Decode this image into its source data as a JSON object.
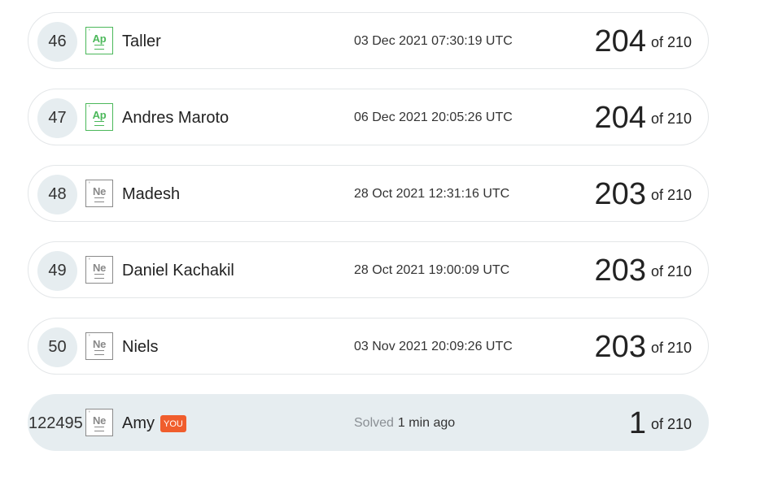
{
  "leaderboard": {
    "rows": [
      {
        "rank": "46",
        "badge": "Ap",
        "name": "Taller",
        "date": "03 Dec 2021 07:30:19 UTC",
        "score": "204",
        "total": "of 210"
      },
      {
        "rank": "47",
        "badge": "Ap",
        "name": "Andres Maroto",
        "date": "06 Dec 2021 20:05:26 UTC",
        "score": "204",
        "total": "of 210"
      },
      {
        "rank": "48",
        "badge": "Ne",
        "name": "Madesh",
        "date": "28 Oct 2021 12:31:16 UTC",
        "score": "203",
        "total": "of 210"
      },
      {
        "rank": "49",
        "badge": "Ne",
        "name": "Daniel Kachakil",
        "date": "28 Oct 2021 19:00:09 UTC",
        "score": "203",
        "total": "of 210"
      },
      {
        "rank": "50",
        "badge": "Ne",
        "name": "Niels",
        "date": "03 Nov 2021 20:09:26 UTC",
        "score": "203",
        "total": "of 210"
      }
    ],
    "current_user": {
      "rank": "122495",
      "badge": "Ne",
      "name": "Amy",
      "you_label": "YOU",
      "solved_label": "Solved",
      "solved_value": "1 min ago",
      "score": "1",
      "total": "of 210"
    },
    "colors": {
      "badge_green": "#4bb85a",
      "badge_gray": "#8a8a8a",
      "you_badge": "#f05d2d",
      "highlight_row": "#e6edf0"
    }
  }
}
